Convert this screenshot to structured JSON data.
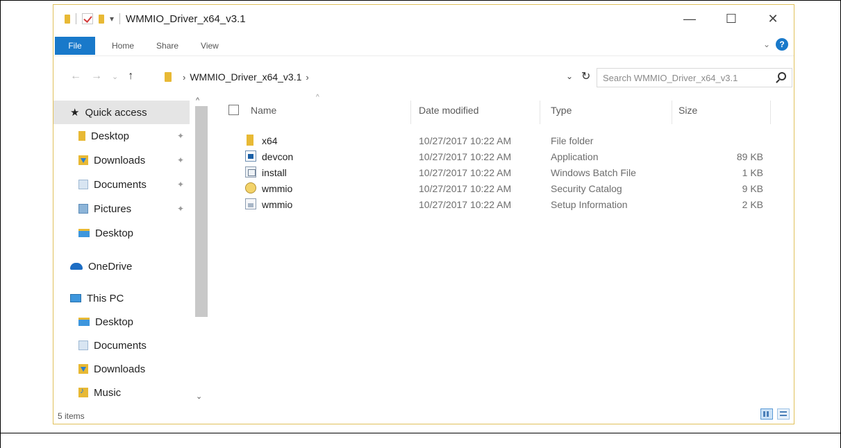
{
  "window": {
    "title": "WMMIO_Driver_x64_v3.1",
    "controls": {
      "minimize": "—",
      "maximize": "☐",
      "close": "✕"
    }
  },
  "ribbon": {
    "tabs": [
      "File",
      "Home",
      "Share",
      "View"
    ],
    "help": "?"
  },
  "address": {
    "back": "←",
    "forward": "→",
    "recent": "⌄",
    "up": "↑",
    "crumb": "WMMIO_Driver_x64_v3.1",
    "search_placeholder": "Search WMMIO_Driver_x64_v3.1"
  },
  "nav_pane": {
    "items": [
      {
        "label": "Quick access",
        "icon": "star-icon"
      },
      {
        "label": "Desktop",
        "icon": "folder-icon",
        "pinned": true
      },
      {
        "label": "Downloads",
        "icon": "downloads-icon",
        "pinned": true
      },
      {
        "label": "Documents",
        "icon": "documents-icon",
        "pinned": true
      },
      {
        "label": "Pictures",
        "icon": "pictures-icon",
        "pinned": true
      },
      {
        "label": "Desktop",
        "icon": "desktop-icon"
      },
      {
        "label": "OneDrive",
        "icon": "onedrive-icon"
      },
      {
        "label": "This PC",
        "icon": "this-pc-icon"
      },
      {
        "label": "Desktop",
        "icon": "desktop-icon"
      },
      {
        "label": "Documents",
        "icon": "documents-icon"
      },
      {
        "label": "Downloads",
        "icon": "downloads-icon"
      },
      {
        "label": "Music",
        "icon": "music-icon"
      }
    ]
  },
  "file_list": {
    "columns": [
      "Name",
      "Date modified",
      "Type",
      "Size"
    ],
    "rows": [
      {
        "name": "x64",
        "date": "10/27/2017 10:22 AM",
        "type": "File folder",
        "size": "",
        "icon": "folder-icon"
      },
      {
        "name": "devcon",
        "date": "10/27/2017 10:22 AM",
        "type": "Application",
        "size": "89 KB",
        "icon": "application-icon"
      },
      {
        "name": "install",
        "date": "10/27/2017 10:22 AM",
        "type": "Windows Batch File",
        "size": "1 KB",
        "icon": "batch-file-icon"
      },
      {
        "name": "wmmio",
        "date": "10/27/2017 10:22 AM",
        "type": "Security Catalog",
        "size": "9 KB",
        "icon": "security-catalog-icon"
      },
      {
        "name": "wmmio",
        "date": "10/27/2017 10:22 AM",
        "type": "Setup Information",
        "size": "2 KB",
        "icon": "setup-information-icon"
      }
    ]
  },
  "status": {
    "items": "5 items"
  },
  "colors": {
    "accent": "#1979ca",
    "folder": "#e8b935",
    "selection": "#e5e5e5"
  }
}
